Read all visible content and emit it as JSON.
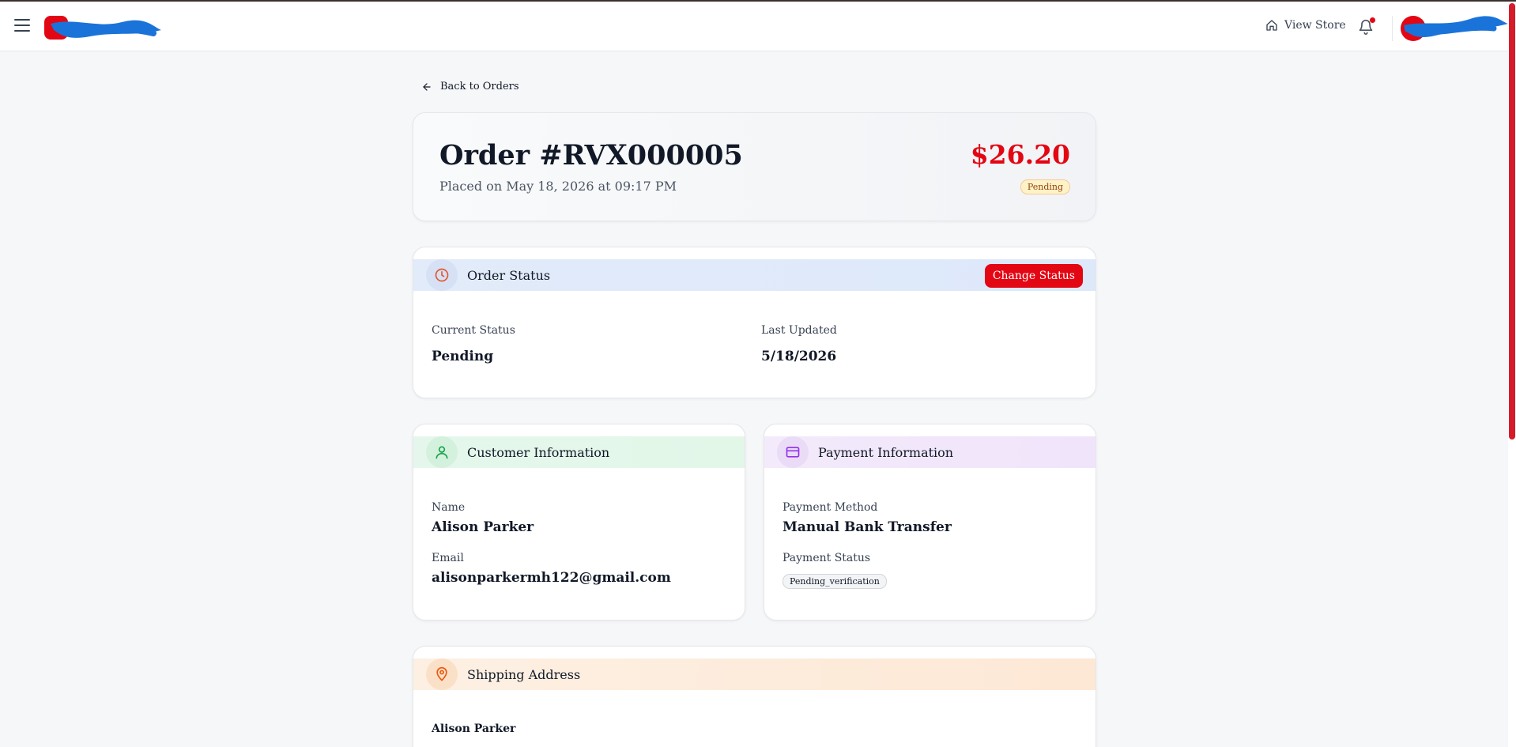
{
  "header": {
    "view_store_label": "View Store"
  },
  "back_link": "Back to Orders",
  "order": {
    "title": "Order #RVX000005",
    "placed": "Placed on May 18, 2026 at 09:17 PM",
    "total": "$26.20",
    "badge": "Pending"
  },
  "status_section": {
    "title": "Order Status",
    "button": "Change Status",
    "current_label": "Current Status",
    "current_value": "Pending",
    "updated_label": "Last Updated",
    "updated_value": "5/18/2026"
  },
  "customer_section": {
    "title": "Customer Information",
    "name_label": "Name",
    "name_value": "Alison Parker",
    "email_label": "Email",
    "email_value": "alisonparkermh122@gmail.com"
  },
  "payment_section": {
    "title": "Payment Information",
    "method_label": "Payment Method",
    "method_value": "Manual Bank Transfer",
    "status_label": "Payment Status",
    "status_value": "Pending_verification"
  },
  "shipping_section": {
    "title": "Shipping Address",
    "name": "Alison Parker"
  },
  "colors": {
    "accent": "#e30613",
    "pending_badge_bg": "#fef3c7",
    "status_header": "#dde8fb",
    "customer_header": "#e2f7e8",
    "payment_header": "#f0e4fa",
    "shipping_header": "#fde8d5"
  },
  "icons": [
    "menu-icon",
    "home-icon",
    "bell-icon",
    "arrow-left-icon",
    "clock-icon",
    "user-icon",
    "credit-card-icon",
    "map-pin-icon"
  ]
}
